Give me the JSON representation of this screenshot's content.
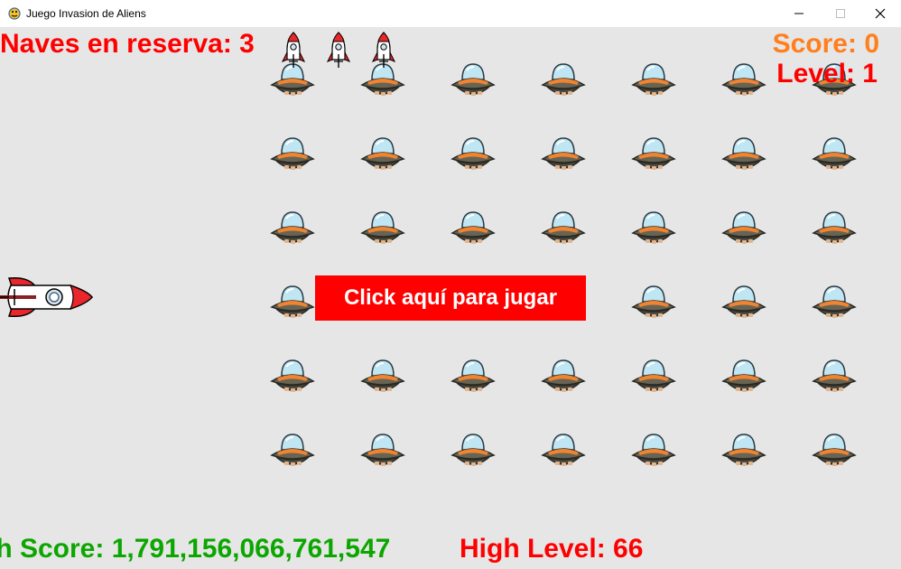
{
  "window": {
    "title": "Juego Invasion de Aliens",
    "icon": "pygame-snake-icon",
    "controls": [
      "minimize-icon",
      "maximize-icon",
      "close-icon"
    ]
  },
  "hud": {
    "reserve_label": "Naves en reserva: 3",
    "reserve_ships": 3,
    "score_label": "Score: 0",
    "level_label": "Level: 1",
    "high_score_label": "gh Score: 1,791,156,066,761,547",
    "high_level_label": "High Level: 66"
  },
  "play_button": {
    "label": "Click aquí para jugar"
  },
  "aliens": {
    "rows": 6,
    "columns": 7
  },
  "player_ship": {
    "icon": "rocket-ship-icon",
    "facing": "right"
  },
  "colors": {
    "background": "#e6e6e6",
    "reserve_text": "#ff0000",
    "score_text": "#ff7f1e",
    "level_text": "#ff0000",
    "high_score_text": "#0ca600",
    "high_level_text": "#ff0000",
    "button_bg": "#ff0000",
    "button_text": "#ffffff"
  }
}
